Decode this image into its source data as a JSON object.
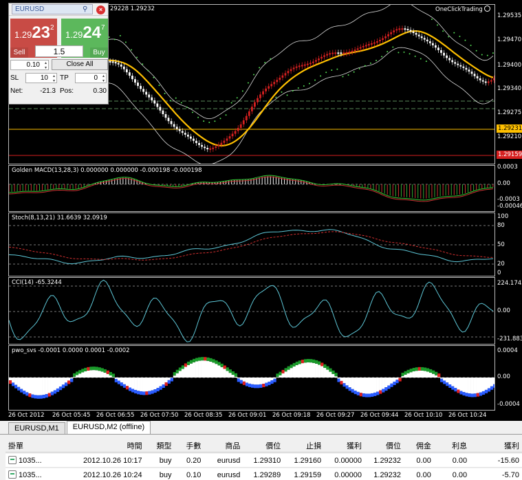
{
  "one_click_trading_label": "OneClickTrading",
  "ohlc_fragment": "29228 1.29232",
  "trade_panel": {
    "symbol": "EURUSD",
    "sell": {
      "prefix": "1.29",
      "big": "23",
      "small": "2",
      "label": "Sell"
    },
    "buy": {
      "prefix": "1.29",
      "big": "24",
      "small": "7",
      "label": "Buy"
    },
    "lot": "1.5",
    "volume": "0.10",
    "close_all": "Close All",
    "sl_label": "SL",
    "sl_value": "10",
    "tp_label": "TP",
    "tp_value": "0",
    "net_label": "Net:",
    "net_value": "-21.3",
    "pos_label": "Pos:",
    "pos_value": "0.30"
  },
  "price_axis": {
    "labels": [
      "1.29535",
      "1.29470",
      "1.29400",
      "1.29340",
      "1.29275",
      "1.29210"
    ],
    "current_price": "1.29231",
    "sl_price": "1.29159"
  },
  "macd": {
    "label": "Golden MACD(13,28,3) 0.000000 0.000000 -0.000198 -0.000198",
    "axis": [
      "0.0003",
      "0.00",
      "-0.0003",
      "-0.00046"
    ]
  },
  "stoch": {
    "label": "Stoch(8,13,21) 31.6639 32.0919",
    "axis": [
      "100",
      "80",
      "50",
      "20",
      "0"
    ]
  },
  "cci": {
    "label": "CCI(14) -65.3244",
    "axis": [
      "224.1743",
      "0.00",
      "-231.8838"
    ]
  },
  "pwo": {
    "label": "pwo_svs -0.0001 0.0000 0.0001 -0.0002",
    "axis": [
      "0.0004",
      "0.00",
      "-0.0004"
    ]
  },
  "time_axis": [
    "26 Oct 2012",
    "26 Oct 05:45",
    "26 Oct 06:55",
    "26 Oct 07:50",
    "26 Oct 08:35",
    "26 Oct 09:01",
    "26 Oct 09:18",
    "26 Oct 09:27",
    "26 Oct 09:44",
    "26 Oct 10:10",
    "26 Oct 10:24"
  ],
  "tabs": [
    "EURUSD,M1",
    "EURUSD,M2 (offline)"
  ],
  "table": {
    "headers": [
      "掛單",
      "時間",
      "類型",
      "手數",
      "商品",
      "價位",
      "止損",
      "獲利",
      "價位",
      "佣金",
      "利息",
      "獲利"
    ],
    "rows": [
      [
        "1035...",
        "2012.10.26 10:17",
        "buy",
        "0.20",
        "eurusd",
        "1.29310",
        "1.29160",
        "0.00000",
        "1.29232",
        "0.00",
        "0.00",
        "-15.60"
      ],
      [
        "1035...",
        "2012.10.26 10:24",
        "buy",
        "0.10",
        "eurusd",
        "1.29289",
        "1.29159",
        "0.00000",
        "1.29232",
        "0.00",
        "0.00",
        "-5.70"
      ]
    ]
  },
  "colors": {
    "bull": "#d62020",
    "bear": "#ffffff",
    "ma": "#ffc000",
    "psar": "#55dd55",
    "price_line": "#ffc000",
    "sl_line": "#d62020"
  }
}
